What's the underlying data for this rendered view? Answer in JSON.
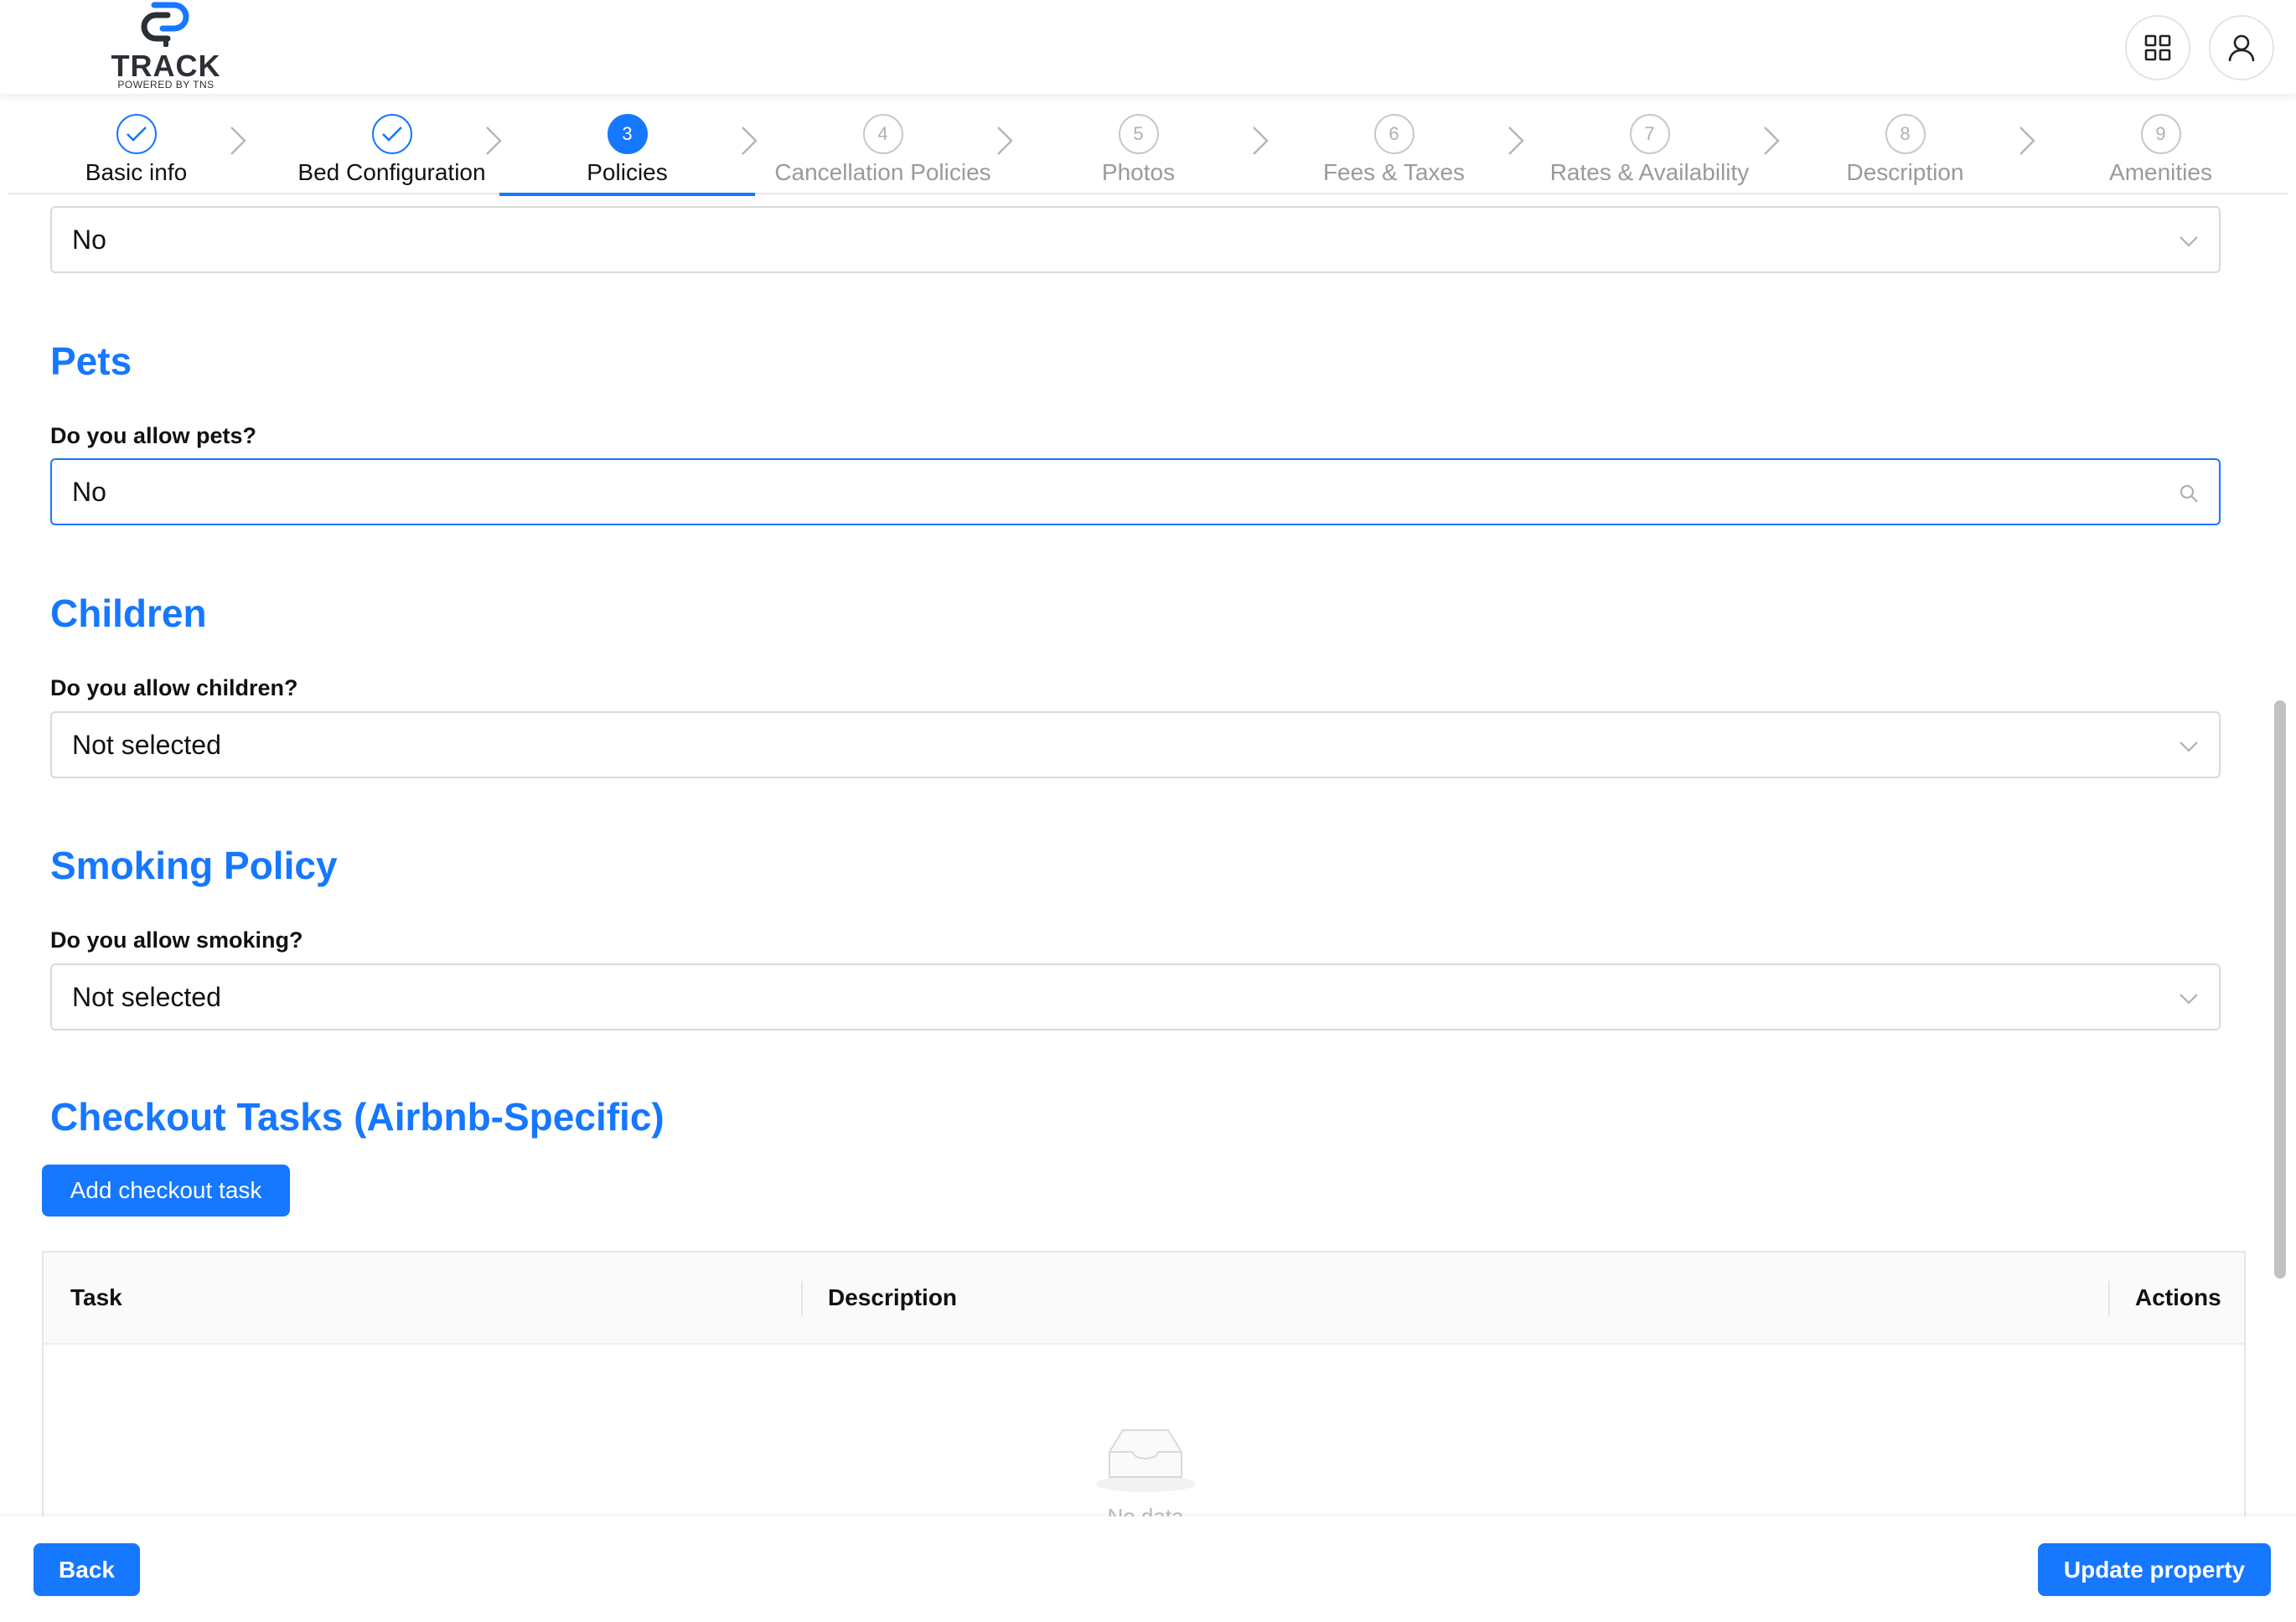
{
  "brand": {
    "name": "TRACK",
    "tagline": "POWERED BY TNS"
  },
  "header": {
    "apps_icon": "grid-icon",
    "user_icon": "user-icon"
  },
  "steps": [
    {
      "number": "1",
      "label": "Basic info",
      "status": "done"
    },
    {
      "number": "2",
      "label": "Bed Configuration",
      "status": "done"
    },
    {
      "number": "3",
      "label": "Policies",
      "status": "active"
    },
    {
      "number": "4",
      "label": "Cancellation Policies",
      "status": "wait"
    },
    {
      "number": "5",
      "label": "Photos",
      "status": "wait"
    },
    {
      "number": "6",
      "label": "Fees & Taxes",
      "status": "wait"
    },
    {
      "number": "7",
      "label": "Rates & Availability",
      "status": "wait"
    },
    {
      "number": "8",
      "label": "Description",
      "status": "wait"
    },
    {
      "number": "9",
      "label": "Amenities",
      "status": "wait"
    }
  ],
  "top_select": {
    "value": "No"
  },
  "pets": {
    "title": "Pets",
    "question": "Do you allow pets?",
    "value": "No"
  },
  "children": {
    "title": "Children",
    "question": "Do you allow children?",
    "value": "Not selected"
  },
  "smoking": {
    "title": "Smoking Policy",
    "question": "Do you allow smoking?",
    "value": "Not selected"
  },
  "checkout": {
    "title": "Checkout Tasks (Airbnb-Specific)",
    "add_button": "Add checkout task",
    "columns": [
      "Task",
      "Description",
      "Actions"
    ],
    "empty_text": "No data"
  },
  "footer": {
    "back": "Back",
    "update": "Update property"
  },
  "colors": {
    "primary": "#1677ff",
    "border": "#d9d9d9"
  }
}
